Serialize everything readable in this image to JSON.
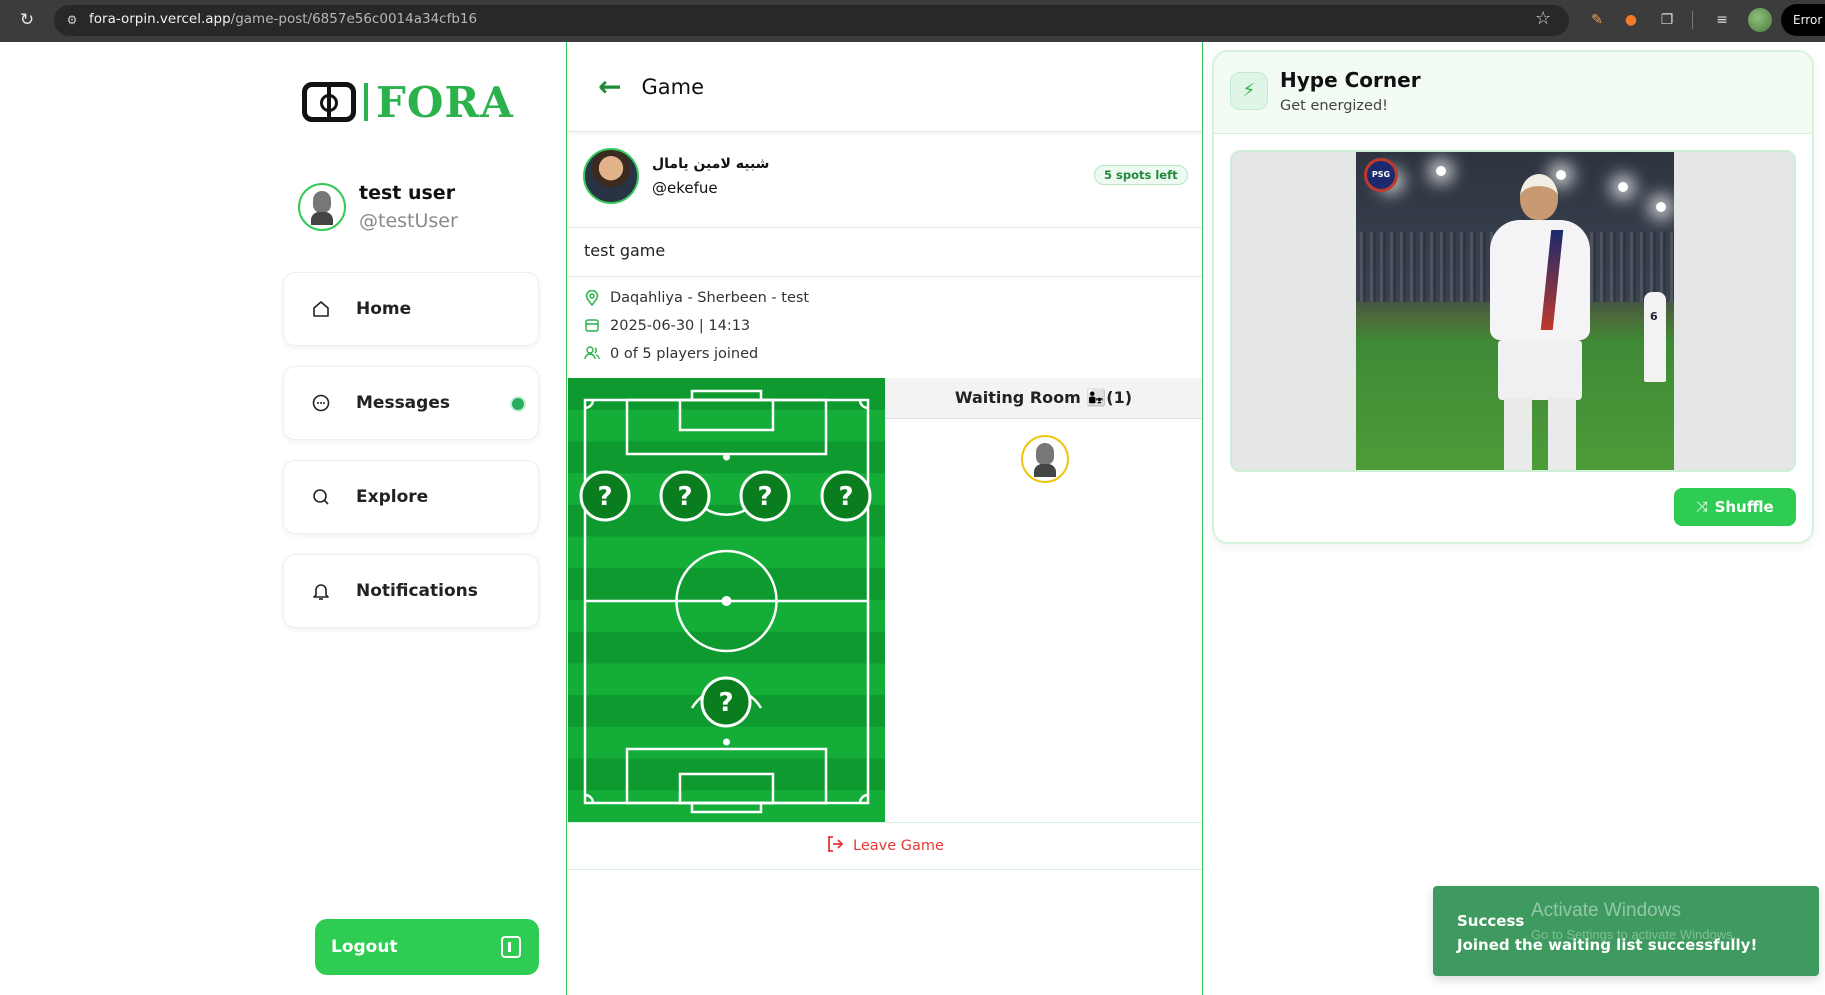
{
  "browser": {
    "url_host": "fora-orpin.vercel.app",
    "url_path": "/game-post/6857e56c0014a34cfb16",
    "error_label": "Error"
  },
  "sidebar": {
    "logo_text": "FORA",
    "user": {
      "name": "test user",
      "handle": "@testUser"
    },
    "nav": [
      {
        "label": "Home",
        "icon": "home-icon"
      },
      {
        "label": "Messages",
        "icon": "message-icon",
        "unread": true
      },
      {
        "label": "Explore",
        "icon": "search-icon"
      },
      {
        "label": "Notifications",
        "icon": "bell-icon"
      }
    ],
    "logout_label": "Logout"
  },
  "game": {
    "header_title": "Game",
    "poster": {
      "name": "شبيه لامين يامال",
      "handle": "@ekefue"
    },
    "spots_badge": "5 spots left",
    "title": "test game",
    "location": "Daqahliya - Sherbeen - test",
    "datetime": "2025-06-30 | 14:13",
    "players": "0 of 5 players joined",
    "slot_label": "?",
    "waiting_room_title": "Waiting Room 👨‍👧(1)",
    "leave_label": "Leave Game"
  },
  "hype": {
    "title": "Hype Corner",
    "subtitle": "Get energized!",
    "shuffle_label": "Shuffle",
    "photo_number": "6"
  },
  "toast": {
    "title": "Success",
    "message": "Joined the waiting list successfully!"
  },
  "watermark": {
    "line1": "Activate Windows",
    "line2": "Go to Settings to activate Windows."
  },
  "colors": {
    "accent": "#2ecc52",
    "pitch_dark": "#0e9a2e",
    "pitch_light": "#13ad38",
    "leave": "#e53935"
  }
}
